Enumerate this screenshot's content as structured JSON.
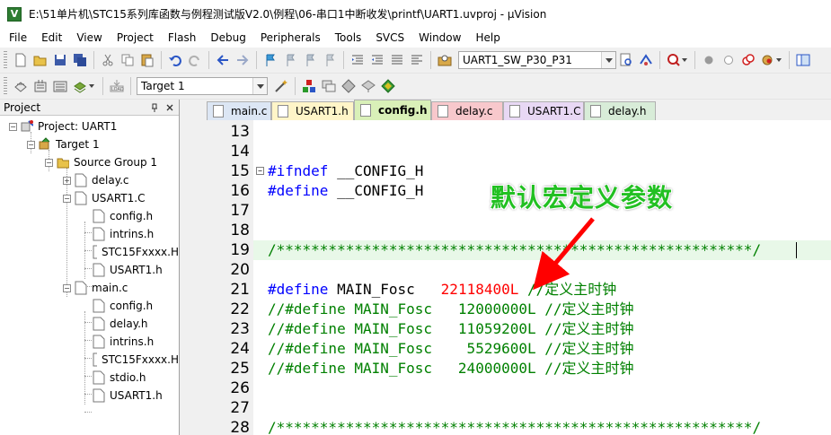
{
  "window": {
    "title": "E:\\51单片机\\STC15系列库函数与例程测试版V2.0\\例程\\06-串口1中断收发\\printf\\UART1.uvproj - µVision",
    "app_icon": "uvision-icon"
  },
  "menu": [
    "File",
    "Edit",
    "View",
    "Project",
    "Flash",
    "Debug",
    "Peripherals",
    "Tools",
    "SVCS",
    "Window",
    "Help"
  ],
  "toolbar1": {
    "target_combo": "UART1_SW_P30_P31"
  },
  "toolbar2": {
    "target_select": "Target 1"
  },
  "project_panel": {
    "title": "Project",
    "pin_icon": "pin-icon",
    "close_icon": "close-icon",
    "tree": {
      "root": "Project: UART1",
      "target": "Target 1",
      "group": "Source Group 1",
      "delay_c": "delay.c",
      "usart1_c": "USART1.C",
      "usart1_children": [
        "config.h",
        "intrins.h",
        "STC15Fxxxx.H",
        "USART1.h"
      ],
      "main_c": "main.c",
      "main_children": [
        "config.h",
        "delay.h",
        "intrins.h",
        "STC15Fxxxx.H",
        "stdio.h",
        "USART1.h"
      ]
    }
  },
  "tabs": [
    {
      "label": "main.c",
      "color": "#dce6f4"
    },
    {
      "label": "USART1.h",
      "color": "#fff5c8"
    },
    {
      "label": "config.h",
      "color": "#d9f0b8",
      "active": true
    },
    {
      "label": "delay.c",
      "color": "#f8c8cc"
    },
    {
      "label": "USART1.C",
      "color": "#e8d8f4"
    },
    {
      "label": "delay.h",
      "color": "#d8ecd8"
    }
  ],
  "code": {
    "lines": [
      {
        "n": "13",
        "parts": []
      },
      {
        "n": "14",
        "parts": []
      },
      {
        "n": "15",
        "parts": [
          {
            "t": "#ifndef",
            "c": "kw"
          },
          {
            "t": "\t__CONFIG_H",
            "c": "black"
          }
        ],
        "fold": "⊟"
      },
      {
        "n": "16",
        "parts": [
          {
            "t": "#define",
            "c": "kw"
          },
          {
            "t": "\t__CONFIG_H",
            "c": "black"
          }
        ]
      },
      {
        "n": "17",
        "parts": []
      },
      {
        "n": "18",
        "parts": []
      },
      {
        "n": "19",
        "parts": [
          {
            "t": "/*******************************************************/",
            "c": "green"
          }
        ],
        "highlight": true
      },
      {
        "n": "20",
        "parts": []
      },
      {
        "n": "21",
        "parts": [
          {
            "t": "#define",
            "c": "kw"
          },
          {
            "t": " MAIN_Fosc   ",
            "c": "black"
          },
          {
            "t": "22118400L",
            "c": "red"
          },
          {
            "t": " //定义主时钟",
            "c": "green"
          }
        ]
      },
      {
        "n": "22",
        "parts": [
          {
            "t": "//#define MAIN_Fosc   12000000L //定义主时钟",
            "c": "green"
          }
        ]
      },
      {
        "n": "23",
        "parts": [
          {
            "t": "//#define MAIN_Fosc   11059200L //定义主时钟",
            "c": "green"
          }
        ]
      },
      {
        "n": "24",
        "parts": [
          {
            "t": "//#define MAIN_Fosc    5529600L //定义主时钟",
            "c": "green"
          }
        ]
      },
      {
        "n": "25",
        "parts": [
          {
            "t": "//#define MAIN_Fosc   24000000L //定义主时钟",
            "c": "green"
          }
        ]
      },
      {
        "n": "26",
        "parts": []
      },
      {
        "n": "27",
        "parts": []
      },
      {
        "n": "28",
        "parts": [
          {
            "t": "/*******************************************************/",
            "c": "green"
          }
        ]
      }
    ]
  },
  "annotation": {
    "text": "默认宏定义参数",
    "color": "#22c022",
    "arrow_color": "#ff0000"
  }
}
